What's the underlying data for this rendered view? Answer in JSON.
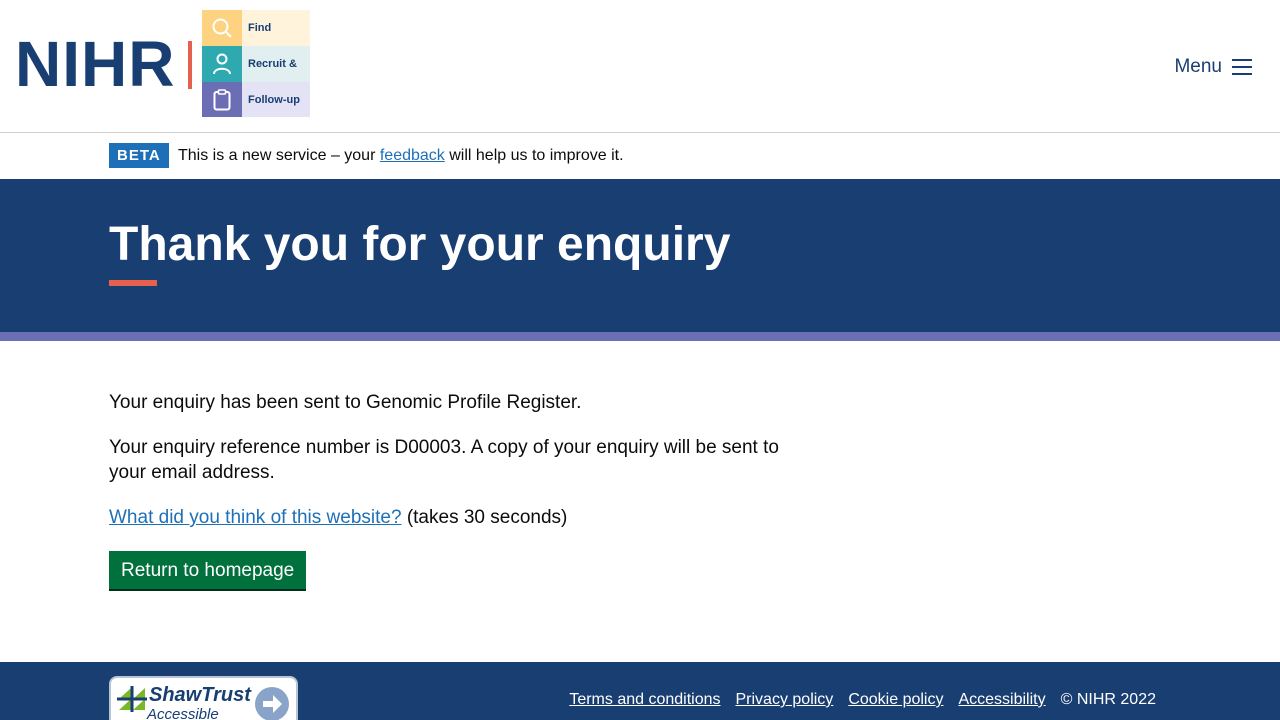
{
  "header": {
    "logo_text": "NIHR",
    "logo_tiles": [
      "Find",
      "Recruit &",
      "Follow-up"
    ],
    "menu_label": "Menu"
  },
  "phase_banner": {
    "tag": "BETA",
    "text_before": "This is a new service – your ",
    "link_text": "feedback",
    "text_after": " will help us to improve it."
  },
  "hero": {
    "title": "Thank you for your enquiry"
  },
  "main": {
    "sent_text": "Your enquiry has been sent to Genomic Profile Register.",
    "reference_text": "Your enquiry reference number is D00003. A copy of your enquiry will be sent to your email address.",
    "survey_link": "What did you think of this website?",
    "survey_suffix": " (takes 30 seconds)",
    "return_button": "Return to homepage"
  },
  "footer": {
    "badge_name": "ShawTrust",
    "badge_sub": "Accessible",
    "links": [
      "Terms and conditions",
      "Privacy policy",
      "Cookie policy",
      "Accessibility"
    ],
    "copyright": "© NIHR 2022"
  },
  "colors": {
    "brand_navy": "#193e72",
    "accent_red": "#e5604d",
    "stripe_purple": "#6b6eb5",
    "link_blue": "#1d70b8",
    "button_green": "#00703c"
  }
}
